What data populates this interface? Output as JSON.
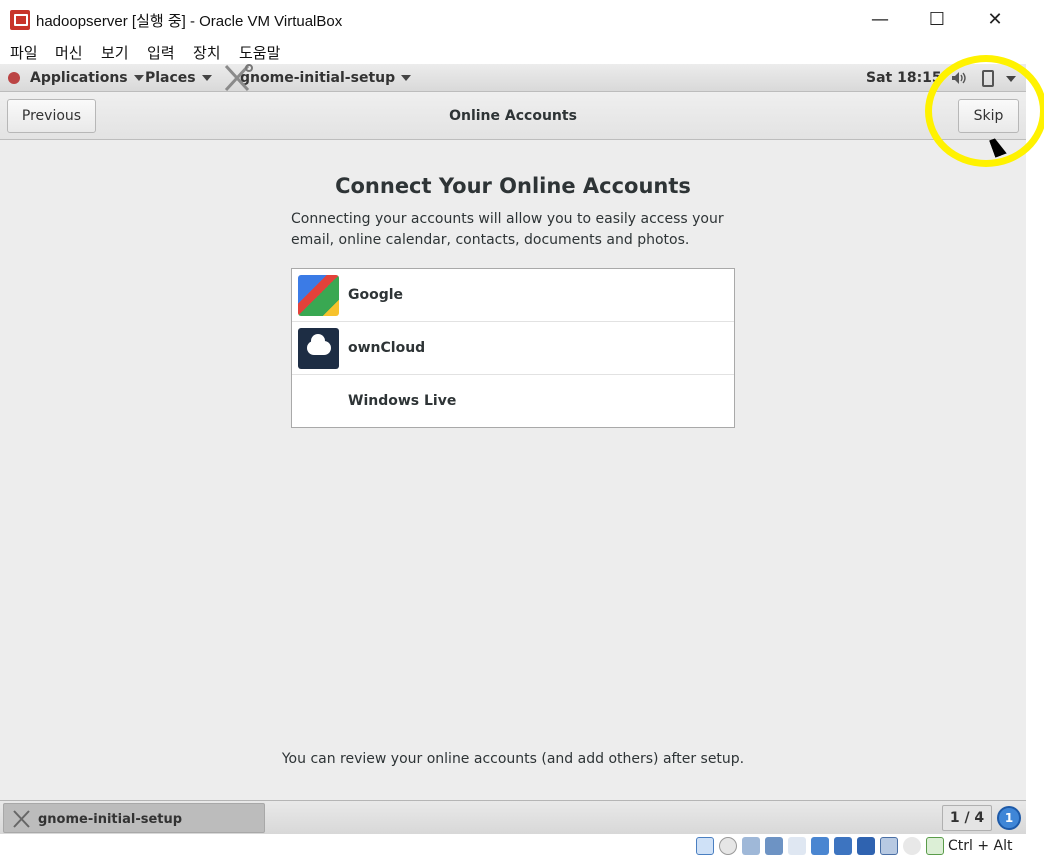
{
  "window": {
    "title": "hadoopserver [실행 중] - Oracle VM VirtualBox",
    "minimize": "—",
    "maximize": "☐",
    "close": "✕"
  },
  "menubar": [
    "파일",
    "머신",
    "보기",
    "입력",
    "장치",
    "도움말"
  ],
  "gnome_bar": {
    "applications": "Applications",
    "places": "Places",
    "app_name": "gnome-initial-setup",
    "clock": "Sat 18:15"
  },
  "header": {
    "previous": "Previous",
    "title": "Online Accounts",
    "skip": "Skip"
  },
  "content": {
    "heading": "Connect Your Online Accounts",
    "description": "Connecting your accounts will allow you to easily access your email, online calendar, contacts, documents and photos.",
    "accounts": [
      {
        "label": "Google",
        "icon": "google-icon"
      },
      {
        "label": "ownCloud",
        "icon": "owncloud-icon"
      },
      {
        "label": "Windows Live",
        "icon": "none"
      }
    ],
    "footer_note": "You can review your online accounts (and add others) after setup."
  },
  "taskbar": {
    "task_label": "gnome-initial-setup",
    "pager": "1 / 4",
    "notifications": "1"
  },
  "vbox_status": {
    "hostkey": "Ctrl + Alt"
  },
  "colors": {
    "highlight": "#fff200",
    "owncloud": "#1d2d44",
    "notification": "#3f86d7"
  }
}
